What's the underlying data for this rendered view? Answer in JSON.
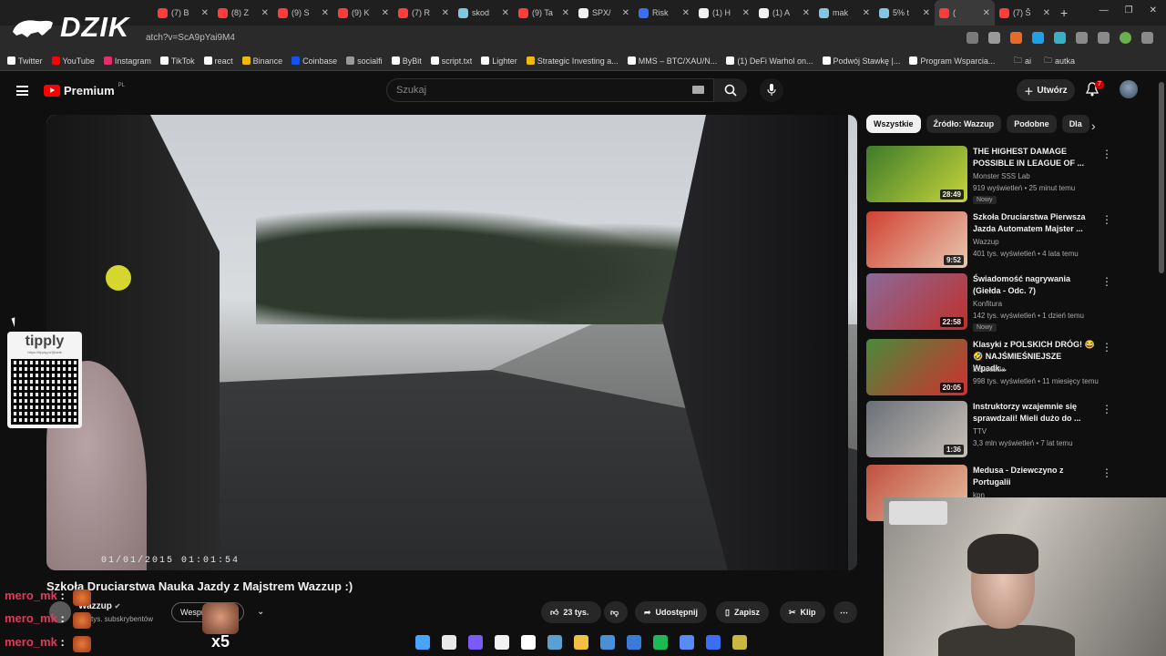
{
  "brand_overlay": {
    "text": "DZIK"
  },
  "tabs": [
    {
      "label": "(7) B",
      "color": "#ff3b3b"
    },
    {
      "label": "(8) Z",
      "color": "#ff3b3b"
    },
    {
      "label": "(9) S",
      "color": "#ff3b3b"
    },
    {
      "label": "(9) K",
      "color": "#ff3b3b"
    },
    {
      "label": "(7) R",
      "color": "#ff3b3b"
    },
    {
      "label": "skod",
      "color": "#7ec8e3"
    },
    {
      "label": "(9) Ta",
      "color": "#ff3b3b"
    },
    {
      "label": "SPX/",
      "color": "#f1f1f1"
    },
    {
      "label": "Risk",
      "color": "#3b6ef5"
    },
    {
      "label": "(1) H",
      "color": "#f1f1f1"
    },
    {
      "label": "(1) A",
      "color": "#f1f1f1"
    },
    {
      "label": "mak",
      "color": "#7ec8e3"
    },
    {
      "label": "5% t",
      "color": "#7ec8e3"
    },
    {
      "label": "(",
      "color": "#ff3b3b",
      "active": true
    },
    {
      "label": "(7) Š",
      "color": "#ff3b3b"
    }
  ],
  "new_tab": "+",
  "address": {
    "url": "atch?v=ScA9pYai9M4"
  },
  "bookmarks": [
    {
      "label": "Twitter",
      "color": "#ffffff"
    },
    {
      "label": "YouTube",
      "color": "#ff0000"
    },
    {
      "label": "Instagram",
      "color": "#e1306c"
    },
    {
      "label": "TikTok",
      "color": "#ffffff"
    },
    {
      "label": "react",
      "color": "#ffffff"
    },
    {
      "label": "Binance",
      "color": "#f0b90b"
    },
    {
      "label": "Coinbase",
      "color": "#1652f0"
    },
    {
      "label": "socialfi",
      "color": "#9a9a9a"
    },
    {
      "label": "ByBit",
      "color": "#ffffff"
    },
    {
      "label": "script.txt",
      "color": "#ffffff"
    },
    {
      "label": "Lighter",
      "color": "#ffffff"
    },
    {
      "label": "Strategic Investing a...",
      "color": "#f0b90b"
    },
    {
      "label": "MMS – BTC/XAU/N...",
      "color": "#ffffff"
    },
    {
      "label": "(1) DeFi Warhol on...",
      "color": "#ffffff"
    },
    {
      "label": "Podwój Stawkę |...",
      "color": "#ffffff"
    },
    {
      "label": "Program Wsparcia...",
      "color": "#ffffff"
    }
  ],
  "bookmarks_right": [
    {
      "label": "ai"
    },
    {
      "label": "autka"
    }
  ],
  "yt": {
    "logo": "Premium",
    "logo_region": "PL",
    "search_placeholder": "Szukaj",
    "create_label": "Utwórz",
    "notifications": "7"
  },
  "video": {
    "timestamp": "01/01/2015 01:01:54",
    "title": "Szkoła Druciarstwa Nauka Jazdy z Majstrem Wazzup :)",
    "channel": "Wazzup",
    "subscribers": "tys. subskrybentów",
    "join_label": "Wespr",
    "likes": "23 tys.",
    "share": "Udostępnij",
    "save": "Zapisz",
    "clip": "Klip"
  },
  "tipply": {
    "title": "tipply",
    "url": "https://tipply.pl/@dzik"
  },
  "chips": [
    {
      "label": "Wszystkie",
      "active": true
    },
    {
      "label": "Źródło: Wazzup"
    },
    {
      "label": "Podobne"
    },
    {
      "label": "Dla"
    }
  ],
  "related": [
    {
      "title": "THE HIGHEST DAMAGE POSSIBLE IN LEAGUE OF ...",
      "channel": "Monster SSS Lab",
      "meta": "919 wyświetleń • 25 minut temu",
      "badge": "Nowy",
      "duration": "28:49",
      "thumb": [
        "#3c7a2a",
        "#c8d53a"
      ]
    },
    {
      "title": "Szkoła Druciarstwa Pierwsza Jazda Automatem Majster ...",
      "channel": "Wazzup",
      "meta": "401 tys. wyświetleń • 4 lata temu",
      "duration": "9:52",
      "thumb": [
        "#d04030",
        "#e8c8b0"
      ]
    },
    {
      "title": "Świadomość nagrywania (Giełda - Odc. 7)",
      "channel": "Konfitura",
      "meta": "142 tys. wyświetleń • 1 dzień temu",
      "badge": "Nowy",
      "duration": "22:58",
      "thumb": [
        "#8a6a9a",
        "#c0302a"
      ]
    },
    {
      "title": "Klasyki z POLSKICH DRÓG! 😂 🤣 NAJŚMIEŚNIEJSZE Wpadk...",
      "channel": "EduJazda",
      "meta": "998 tys. wyświetleń • 11 miesięcy temu",
      "duration": "20:05",
      "thumb": [
        "#4a8a3a",
        "#d03030"
      ]
    },
    {
      "title": "Instruktorzy wzajemnie się sprawdzali! Mieli dużo do ...",
      "channel": "TTV",
      "meta": "3,3 mln wyświetleń • 7 lat temu",
      "duration": "1:36",
      "thumb": [
        "#6a7078",
        "#c8c0b8"
      ]
    },
    {
      "title": "Medusa - Dziewczyno z Portugalii",
      "channel": "kpn",
      "meta": "",
      "duration": "",
      "thumb": [
        "#c05040",
        "#e8c0a0"
      ]
    }
  ],
  "chat": [
    {
      "user": "mero_mk",
      "sep": ":"
    },
    {
      "user": "mero_mk",
      "sep": ":"
    },
    {
      "user": "mero_mk",
      "sep": ":"
    }
  ],
  "emote_multiplier": "x5",
  "taskbar_icons": [
    "#4aa3ff",
    "#e8e8e8",
    "#7a5af8",
    "#f2f2f2",
    "#ffffff",
    "#5aa0d0",
    "#f0c040",
    "#4a90d8",
    "#3a7ad8",
    "#1db954",
    "#5a8af8",
    "#3b6ef5",
    "#c8b840"
  ]
}
